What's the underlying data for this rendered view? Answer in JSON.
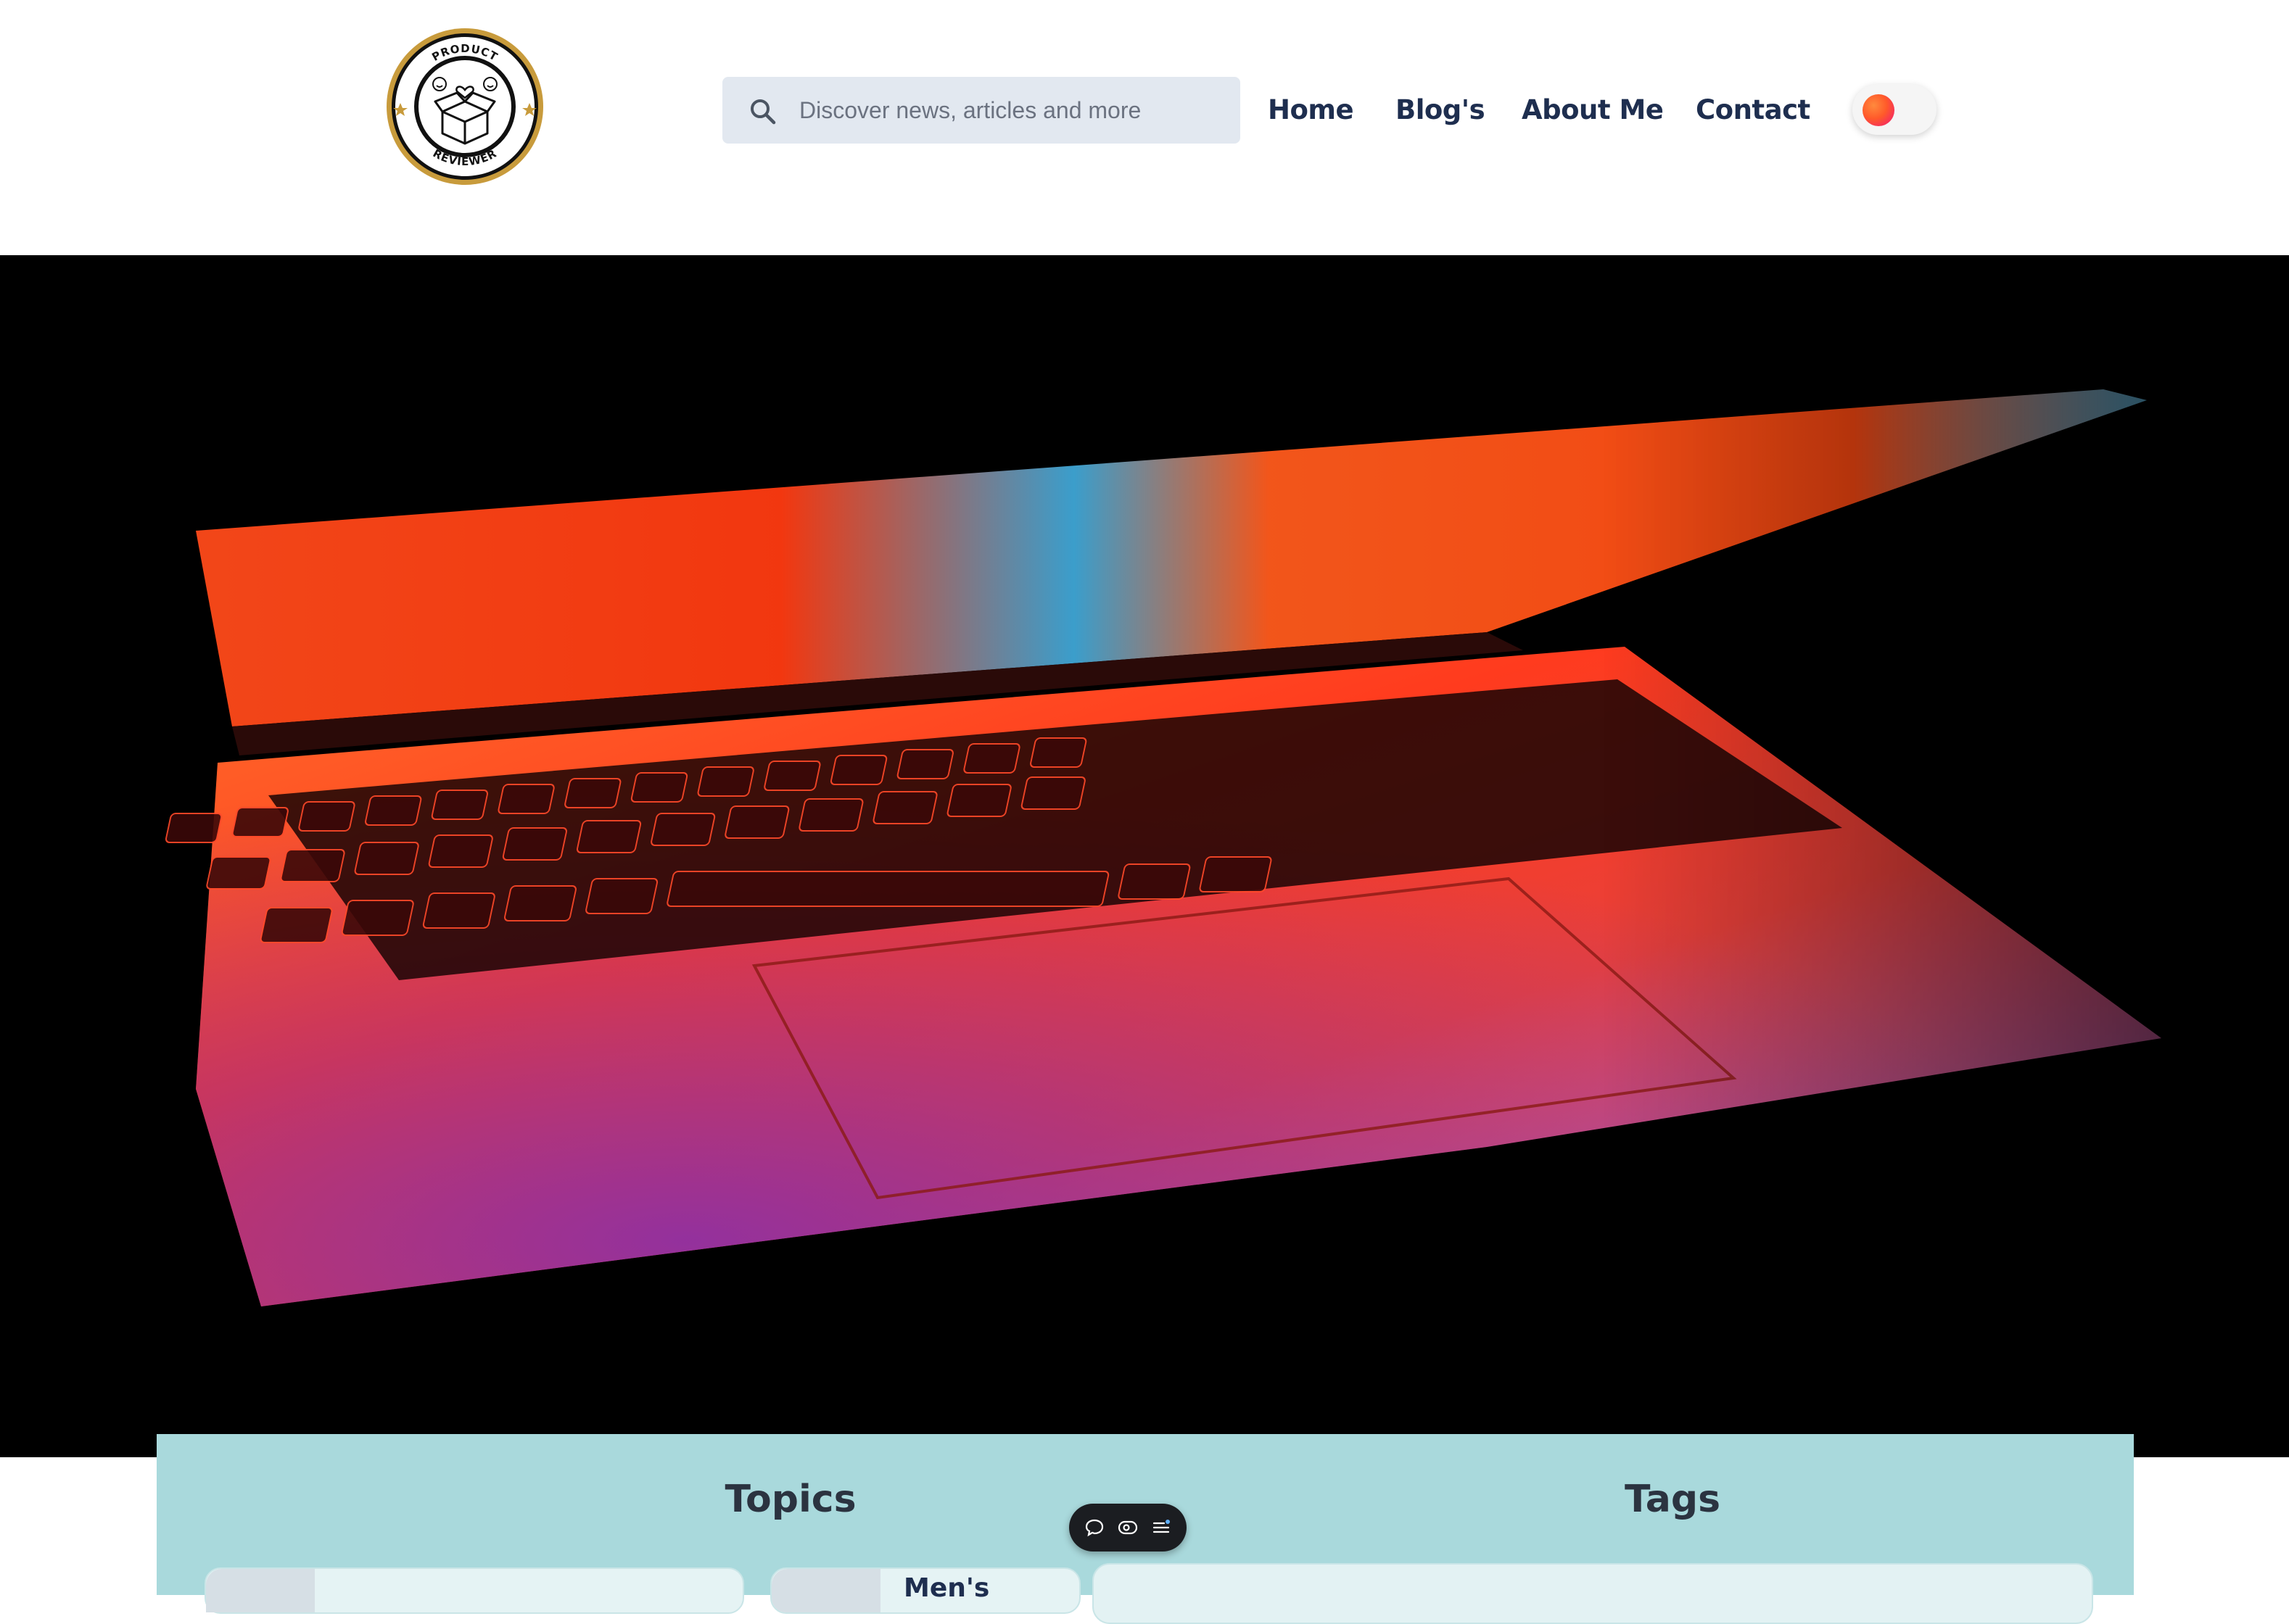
{
  "logo": {
    "top_text": "PRODUCT",
    "bottom_text": "REVIEWER"
  },
  "search": {
    "placeholder": "Discover news, articles and more",
    "icon": "search-icon"
  },
  "nav": [
    {
      "label": "Home"
    },
    {
      "label": "Blog's"
    },
    {
      "label": "About Me"
    },
    {
      "label": "Contact"
    }
  ],
  "theme_toggle": {
    "icon": "theme-toggle-icon",
    "accent": "#ff5a2a"
  },
  "hero": {
    "image": "laptop-keyboard-glowing-screen"
  },
  "sections": {
    "topics_title": "Topics",
    "tags_title": "Tags",
    "topic_cards": [
      {
        "label": ""
      },
      {
        "label": "Men's"
      }
    ]
  },
  "toolbar": {
    "icons": [
      "comment-icon",
      "eye-icon",
      "list-icon"
    ]
  },
  "colors": {
    "nav_text": "#1e2e4f",
    "panel_bg": "#a9d9dc",
    "search_bg": "#e2e8f0"
  }
}
